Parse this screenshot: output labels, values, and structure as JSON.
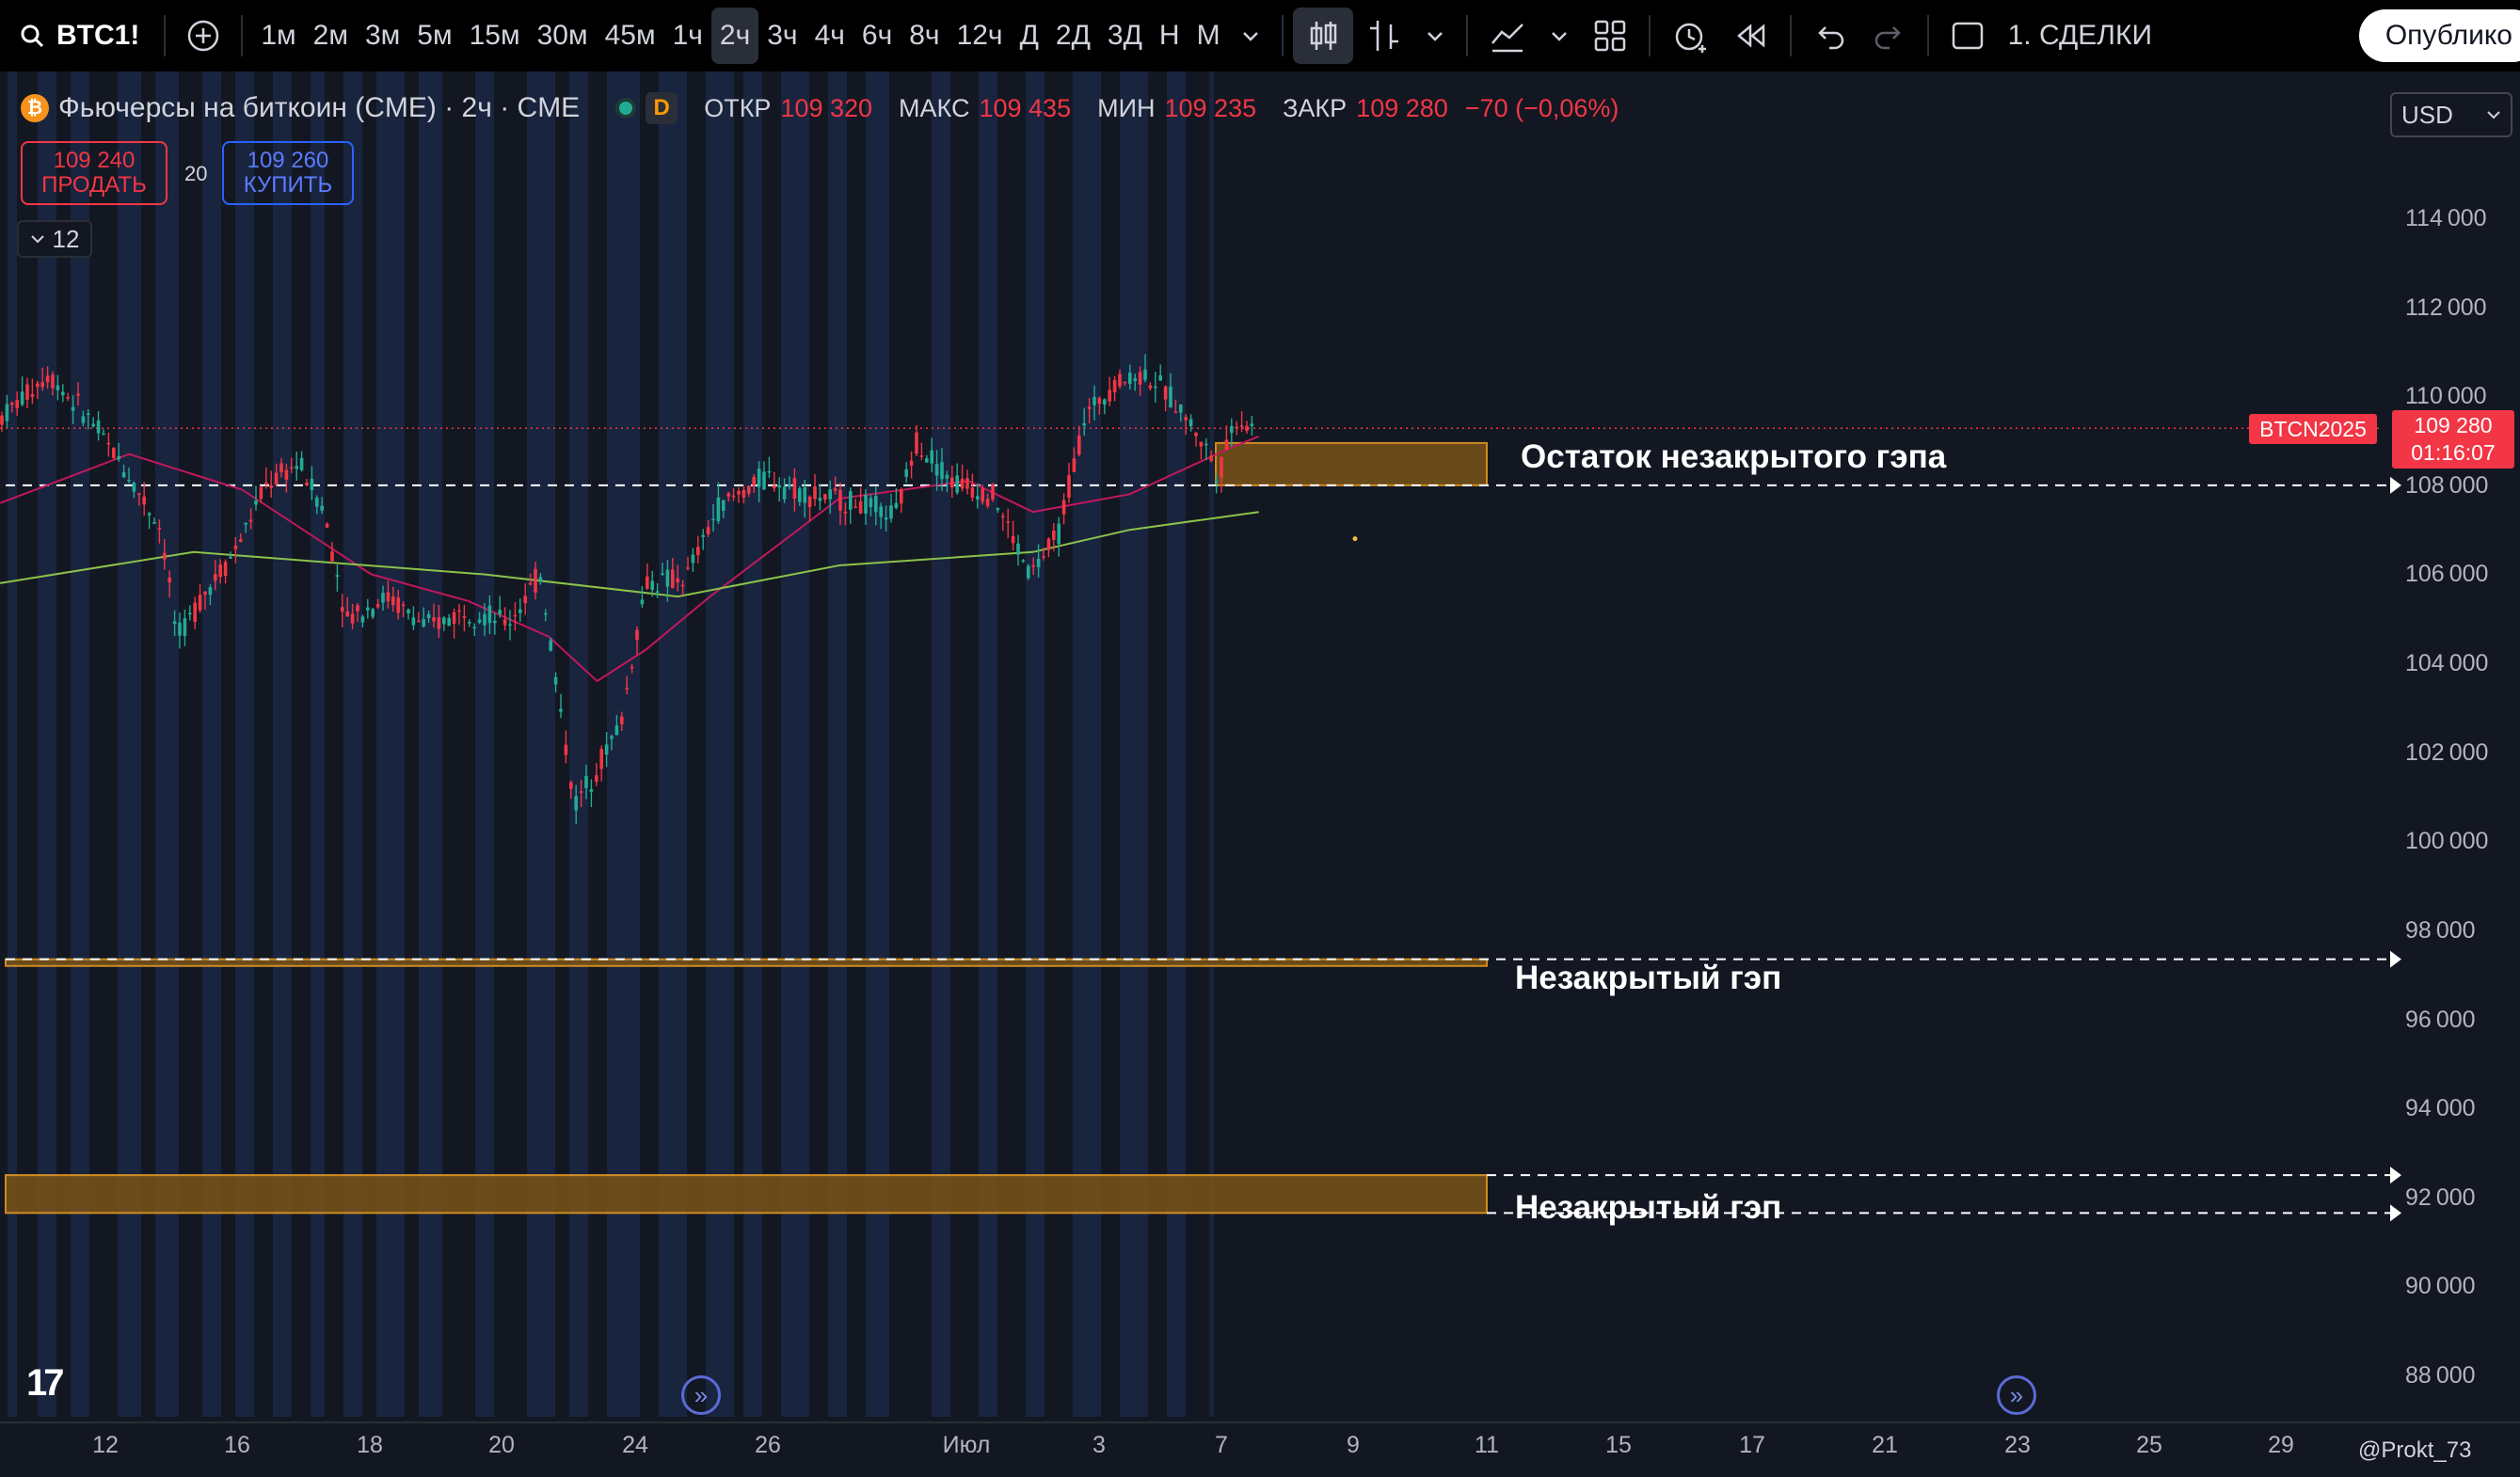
{
  "toolbar": {
    "symbol": "BTC1!",
    "intervals": [
      "1м",
      "2м",
      "3м",
      "5м",
      "15м",
      "30м",
      "45м",
      "1ч",
      "2ч",
      "3ч",
      "4ч",
      "6ч",
      "8ч",
      "12ч",
      "Д",
      "2Д",
      "3Д",
      "Н",
      "М"
    ],
    "active_interval": "2ч",
    "trades_label": "1. СДЕЛКИ",
    "publish_label": "Опублико"
  },
  "legend": {
    "coin_glyph": "₿",
    "title": "Фьючерсы на биткоин (CME) · 2ч · CME",
    "d_badge": "D",
    "open_label": "ОТКР",
    "open": "109 320",
    "high_label": "МАКС",
    "high": "109 435",
    "low_label": "МИН",
    "low": "109 235",
    "close_label": "ЗАКР",
    "close": "109 280",
    "change": "−70 (−0,06%)"
  },
  "trade": {
    "sell_price": "109 240",
    "sell_label": "ПРОДАТЬ",
    "spread": "20",
    "buy_price": "109 260",
    "buy_label": "КУПИТЬ",
    "collapse_count": "12"
  },
  "currency": "USD",
  "price_tag": {
    "symbol": "BTCN2025",
    "price": "109 280",
    "countdown": "01:16:07"
  },
  "annotations": {
    "gap1": "Остаток незакрытого гэпа",
    "gap2": "Незакрытый гэп",
    "gap3": "Незакрытый гэп"
  },
  "author": "@Prokt_73",
  "colors": {
    "up": "#22ab94",
    "down": "#f23645",
    "ma_fast": "#c2185b",
    "ma_slow": "#8bc34a",
    "gap_fill": "#7a5418",
    "gap_border": "#f0a020",
    "session": "#1c2a4a"
  },
  "chart_data": {
    "type": "candlestick",
    "y_axis": {
      "ticks": [
        88000,
        90000,
        92000,
        94000,
        96000,
        98000,
        100000,
        102000,
        104000,
        106000,
        108000,
        110000,
        112000,
        114000
      ],
      "ylim": [
        87000,
        116000
      ]
    },
    "x_axis": {
      "ticks": [
        "12",
        "16",
        "18",
        "20",
        "24",
        "26",
        "Июл",
        "3",
        "7",
        "9",
        "11",
        "15",
        "17",
        "21",
        "23",
        "25",
        "29"
      ]
    },
    "last_price": 109280,
    "current_price_line": 109280,
    "gaps": [
      {
        "label": "Остаток незакрытого гэпа",
        "low": 108000,
        "high": 108950
      },
      {
        "label": "Незакрытый гэп",
        "low": 97200,
        "high": 97350
      },
      {
        "label": "Незакрытый гэп",
        "low": 91650,
        "high": 92500
      }
    ],
    "anchors": [
      [
        0,
        109500
      ],
      [
        30,
        110500
      ],
      [
        55,
        109500
      ],
      [
        75,
        108500
      ],
      [
        100,
        107000
      ],
      [
        110,
        104500
      ],
      [
        125,
        105500
      ],
      [
        145,
        106500
      ],
      [
        165,
        108000
      ],
      [
        185,
        108500
      ],
      [
        200,
        107500
      ],
      [
        215,
        105000
      ],
      [
        240,
        105500
      ],
      [
        265,
        104800
      ],
      [
        290,
        105200
      ],
      [
        315,
        104900
      ],
      [
        335,
        106000
      ],
      [
        345,
        103500
      ],
      [
        356,
        100800
      ],
      [
        372,
        101800
      ],
      [
        385,
        102700
      ],
      [
        400,
        105800
      ],
      [
        425,
        105900
      ],
      [
        445,
        107500
      ],
      [
        475,
        108200
      ],
      [
        500,
        107800
      ],
      [
        530,
        107600
      ],
      [
        555,
        107300
      ],
      [
        568,
        109000
      ],
      [
        590,
        108100
      ],
      [
        615,
        107800
      ],
      [
        638,
        106000
      ],
      [
        655,
        106800
      ],
      [
        672,
        109500
      ],
      [
        690,
        110300
      ],
      [
        710,
        110500
      ],
      [
        730,
        109800
      ],
      [
        748,
        108800
      ],
      [
        755,
        108200
      ],
      [
        765,
        109500
      ],
      [
        778,
        109300
      ]
    ],
    "ma_fast": [
      [
        0,
        107600
      ],
      [
        80,
        108700
      ],
      [
        150,
        107900
      ],
      [
        230,
        106000
      ],
      [
        290,
        105400
      ],
      [
        340,
        104600
      ],
      [
        370,
        103600
      ],
      [
        400,
        104300
      ],
      [
        440,
        105500
      ],
      [
        520,
        107700
      ],
      [
        600,
        108100
      ],
      [
        640,
        107400
      ],
      [
        700,
        107800
      ],
      [
        760,
        108800
      ],
      [
        780,
        109100
      ]
    ],
    "ma_slow": [
      [
        0,
        105800
      ],
      [
        120,
        106500
      ],
      [
        300,
        106000
      ],
      [
        420,
        105500
      ],
      [
        520,
        106200
      ],
      [
        640,
        106500
      ],
      [
        700,
        107000
      ],
      [
        780,
        107400
      ]
    ]
  }
}
